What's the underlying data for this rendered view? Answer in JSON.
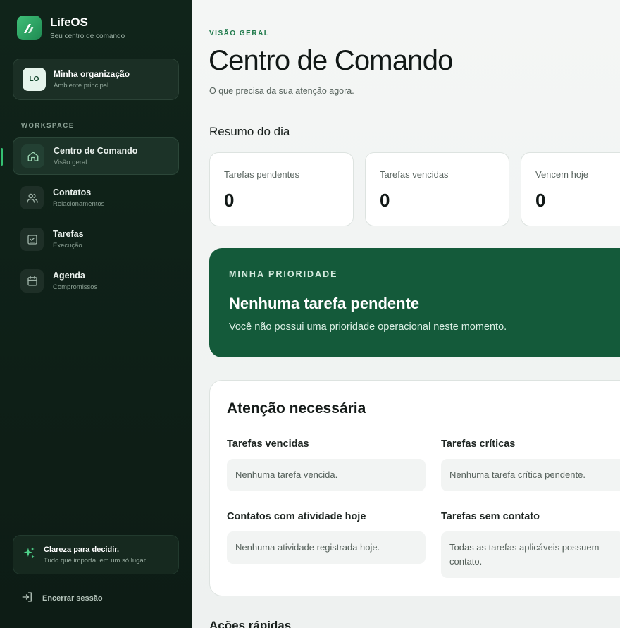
{
  "brand": {
    "name": "LifeOS",
    "tagline": "Seu centro de comando"
  },
  "organization": {
    "initials": "LO",
    "name": "Minha organização",
    "subtitle": "Ambiente principal"
  },
  "sidebar": {
    "section_label": "WORKSPACE",
    "items": [
      {
        "title": "Centro de Comando",
        "subtitle": "Visão geral",
        "icon": "home-icon",
        "active": true
      },
      {
        "title": "Contatos",
        "subtitle": "Relacionamentos",
        "icon": "users-icon",
        "active": false
      },
      {
        "title": "Tarefas",
        "subtitle": "Execução",
        "icon": "checklist-icon",
        "active": false
      },
      {
        "title": "Agenda",
        "subtitle": "Compromissos",
        "icon": "calendar-icon",
        "active": false
      }
    ],
    "tip": {
      "title": "Clareza para decidir.",
      "subtitle": "Tudo que importa, em um só lugar.",
      "icon": "sparkle-icon"
    },
    "logout_label": "Encerrar sessão"
  },
  "header": {
    "eyebrow": "VISÃO GERAL",
    "title": "Centro de Comando",
    "subtitle": "O que precisa da sua atenção agora."
  },
  "summary": {
    "title": "Resumo do dia",
    "cards": [
      {
        "label": "Tarefas pendentes",
        "value": "0"
      },
      {
        "label": "Tarefas vencidas",
        "value": "0"
      },
      {
        "label": "Vencem hoje",
        "value": "0"
      }
    ]
  },
  "priority": {
    "eyebrow": "MINHA PRIORIDADE",
    "title": "Nenhuma tarefa pendente",
    "subtitle": "Você não possui uma prioridade operacional neste momento."
  },
  "attention": {
    "title": "Atenção necessária",
    "blocks": [
      {
        "label": "Tarefas vencidas",
        "message": "Nenhuma tarefa vencida."
      },
      {
        "label": "Tarefas críticas",
        "message": "Nenhuma tarefa crítica pendente."
      },
      {
        "label": "Contatos com atividade hoje",
        "message": "Nenhuma atividade registrada hoje."
      },
      {
        "label": "Tarefas sem contato",
        "message": "Todas as tarefas aplicáveis possuem contato."
      }
    ]
  },
  "quick_actions": {
    "title": "Ações rápidas"
  },
  "colors": {
    "sidebar_bg": "#10241a",
    "accent": "#34c072",
    "priority_bg": "#145a3a",
    "eyebrow": "#1f7a4b"
  }
}
